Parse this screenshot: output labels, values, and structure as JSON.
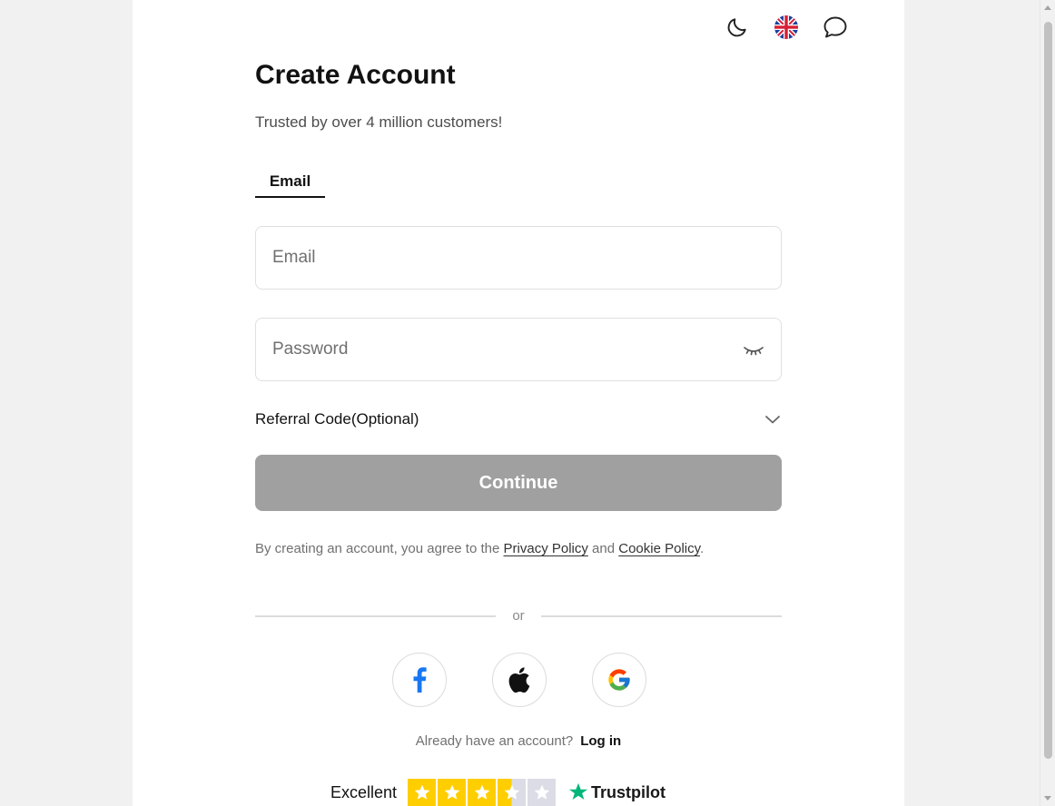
{
  "header": {
    "icons": [
      "moon-icon",
      "uk-flag-icon",
      "chat-bubble-icon"
    ]
  },
  "form": {
    "title": "Create Account",
    "subtitle": "Trusted by over 4 million customers!",
    "tab_label": "Email",
    "email_placeholder": "Email",
    "email_value": "",
    "password_placeholder": "Password",
    "password_value": "",
    "referral_label": "Referral Code(Optional)",
    "continue_label": "Continue",
    "terms_prefix": "By creating an account, you agree to the ",
    "privacy_label": "Privacy Policy",
    "terms_and": " and ",
    "cookie_label": "Cookie Policy",
    "terms_suffix": "."
  },
  "divider": {
    "label": "or"
  },
  "social": {
    "providers": [
      "facebook-icon",
      "apple-icon",
      "google-icon"
    ]
  },
  "login": {
    "prompt": "Already have an account?",
    "link_label": "Log in"
  },
  "trustpilot": {
    "rating_label": "Excellent",
    "stars_filled": 3.5,
    "stars_total": 5,
    "brand": "Trustpilot"
  },
  "colors": {
    "button_disabled": "#a0a0a0",
    "star_yellow": "#ffce00",
    "star_grey": "#dcdce6",
    "trustpilot_green": "#00b67a",
    "facebook_blue": "#1877f2"
  }
}
